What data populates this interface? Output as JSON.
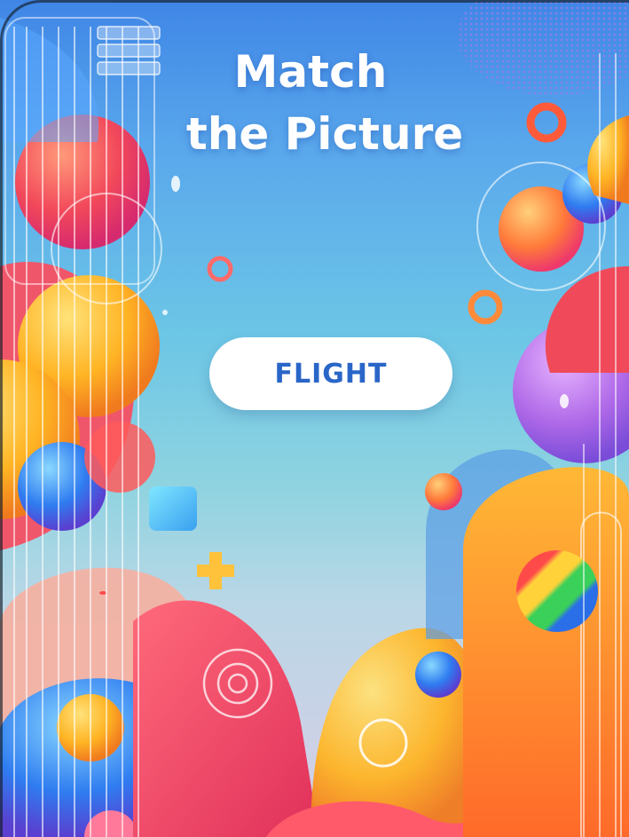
{
  "title": {
    "line1": "Match",
    "line2": "the Picture"
  },
  "word_card": {
    "word": "FLIGHT"
  },
  "colors": {
    "sky_top": "#3f86e6",
    "sky_mid": "#6cc6e6",
    "word_text": "#2a66c8",
    "title_text": "#ffffff"
  }
}
